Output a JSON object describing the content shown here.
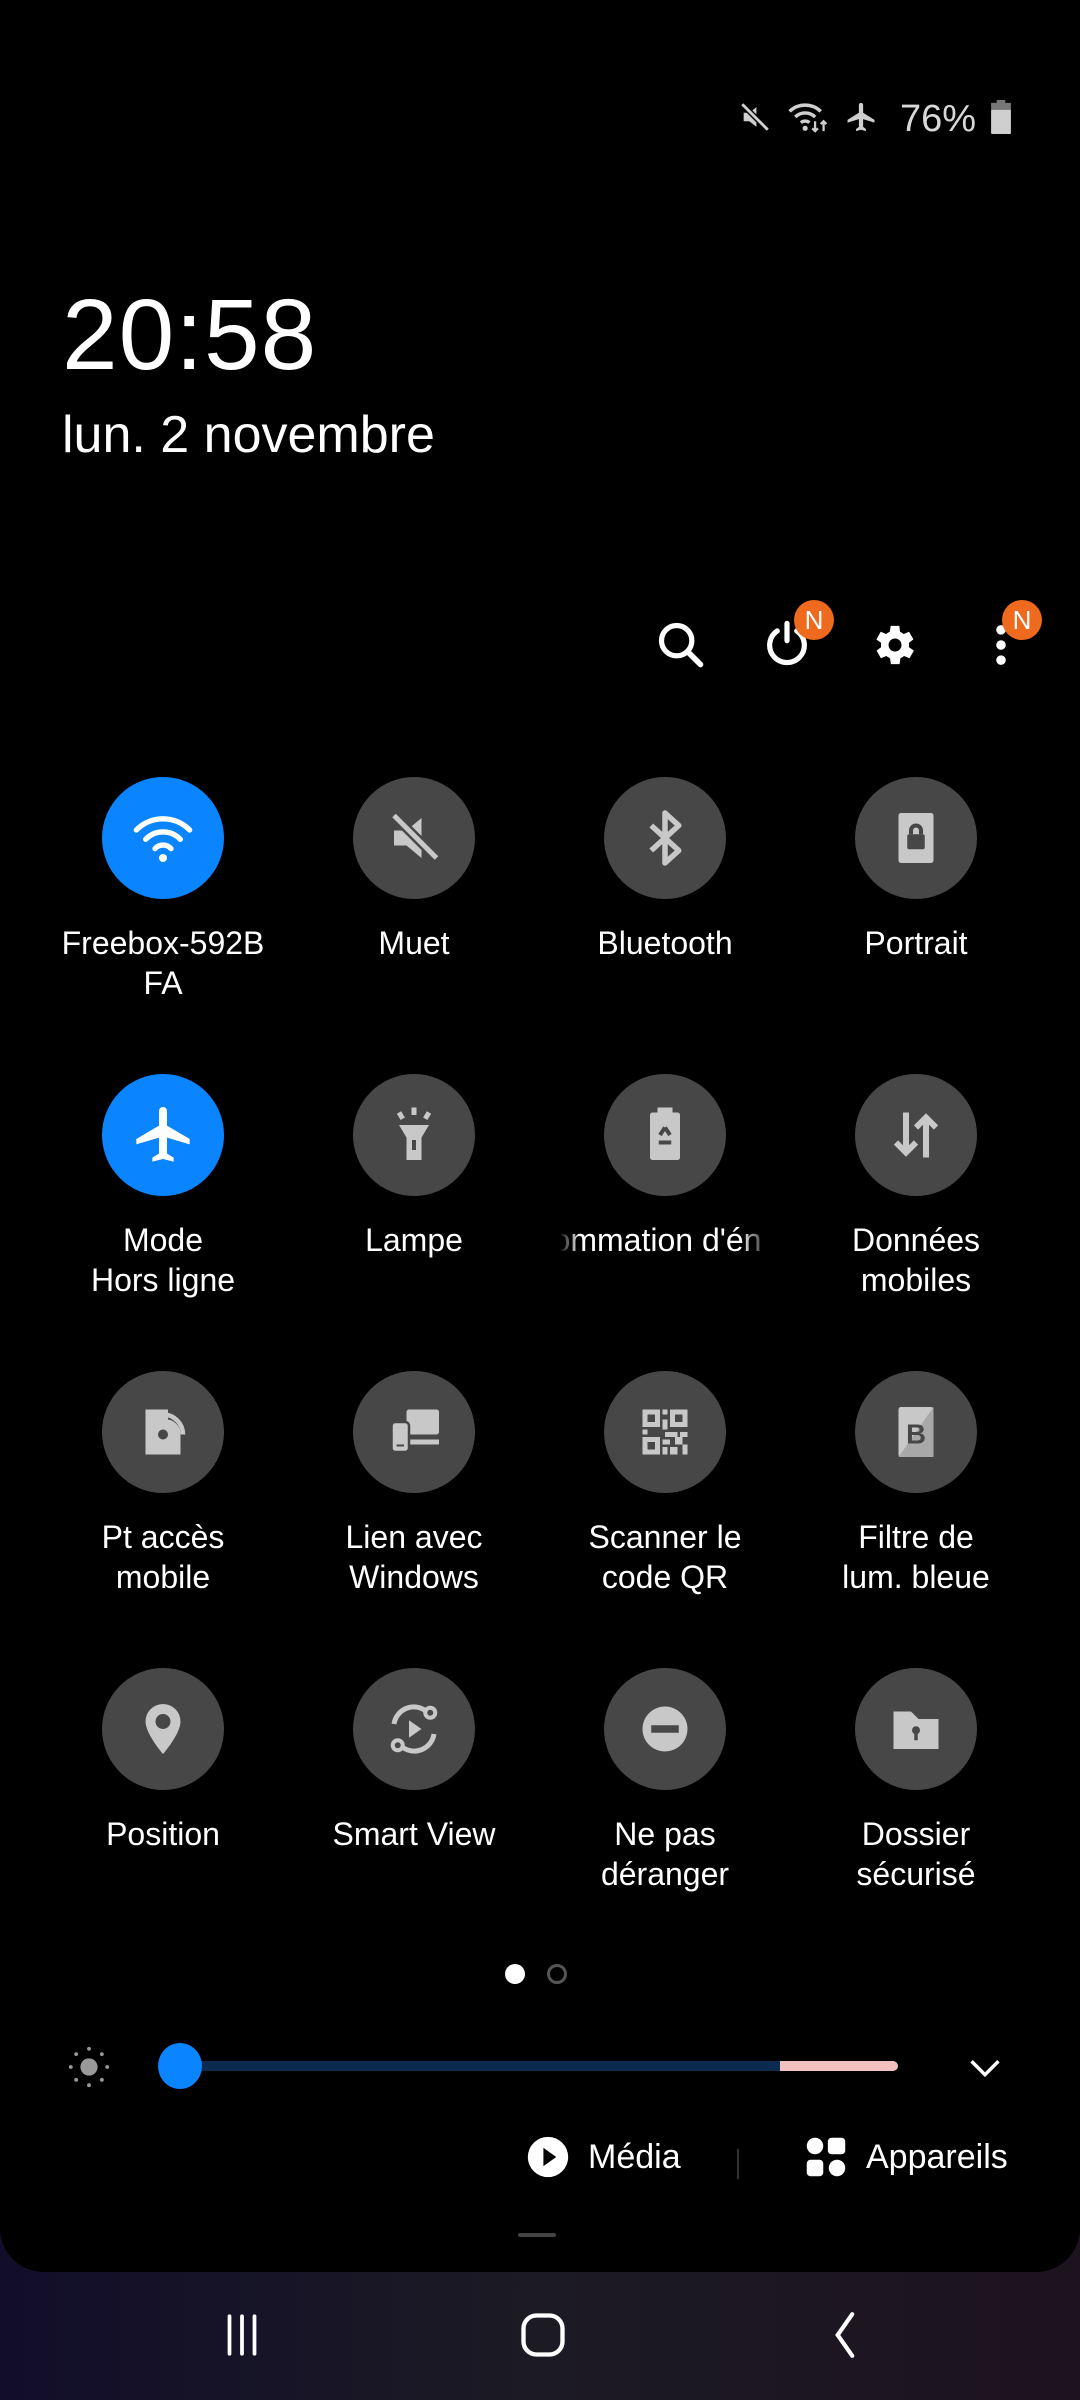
{
  "status_bar": {
    "icons": [
      "mute-icon",
      "wifi-data-icon",
      "airplane-icon"
    ],
    "battery_percent": "76%",
    "battery_icon": "battery-icon"
  },
  "header": {
    "time": "20:58",
    "date": "lun. 2 novembre"
  },
  "toolbar": {
    "search": "search-icon",
    "power": "power-icon",
    "power_badge": "N",
    "settings": "gear-icon",
    "more": "more-vertical-icon",
    "more_badge": "N"
  },
  "tiles": [
    {
      "label": "Freebox-592B\nFA",
      "icon": "wifi-icon",
      "active": true
    },
    {
      "label": "Muet",
      "icon": "mute-icon",
      "active": false
    },
    {
      "label": "Bluetooth",
      "icon": "bluetooth-icon",
      "active": false
    },
    {
      "label": "Portrait",
      "icon": "portrait-lock-icon",
      "active": false
    },
    {
      "label": "Mode\nHors ligne",
      "icon": "airplane-icon",
      "active": true
    },
    {
      "label": "Lampe",
      "icon": "flashlight-icon",
      "active": false
    },
    {
      "label": "ommation d'én",
      "icon": "battery-saver-icon",
      "active": false
    },
    {
      "label": "Données\nmobiles",
      "icon": "mobile-data-icon",
      "active": false
    },
    {
      "label": "Pt accès\nmobile",
      "icon": "hotspot-icon",
      "active": false
    },
    {
      "label": "Lien avec\nWindows",
      "icon": "link-to-windows-icon",
      "active": false
    },
    {
      "label": "Scanner le\ncode QR",
      "icon": "qr-code-icon",
      "active": false
    },
    {
      "label": "Filtre de\nlum. bleue",
      "icon": "blue-light-filter-icon",
      "active": false
    },
    {
      "label": "Position",
      "icon": "location-pin-icon",
      "active": false
    },
    {
      "label": "Smart View",
      "icon": "smart-view-icon",
      "active": false
    },
    {
      "label": "Ne pas\ndéranger",
      "icon": "do-not-disturb-icon",
      "active": false
    },
    {
      "label": "Dossier\nsécurisé",
      "icon": "secure-folder-icon",
      "active": false
    }
  ],
  "pager": {
    "current_page": 1,
    "total_pages": 2
  },
  "brightness": {
    "value_percent": 3,
    "warm_zone_start_percent": 84
  },
  "bottom_actions": {
    "media_label": "Média",
    "devices_label": "Appareils"
  },
  "colors": {
    "accent": "#0a84ff",
    "tile_inactive": "#474747",
    "badge": "#ee6a1e",
    "slider_track": "#0b2a50",
    "slider_warm": "#f3c0c0"
  }
}
